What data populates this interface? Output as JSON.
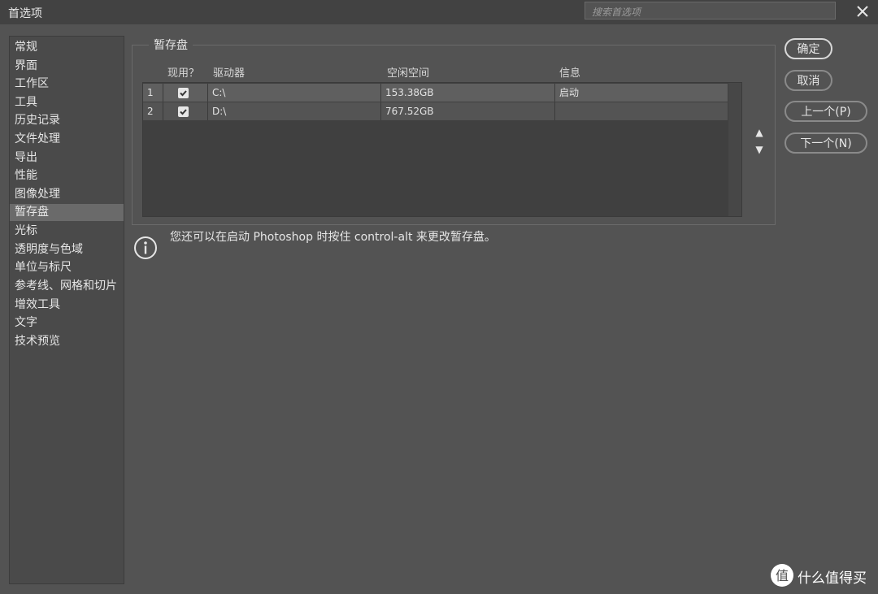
{
  "window": {
    "title": "首选项",
    "search_placeholder": "搜索首选项"
  },
  "sidebar": {
    "items": [
      {
        "label": "常规"
      },
      {
        "label": "界面"
      },
      {
        "label": "工作区"
      },
      {
        "label": "工具"
      },
      {
        "label": "历史记录"
      },
      {
        "label": "文件处理"
      },
      {
        "label": "导出"
      },
      {
        "label": "性能"
      },
      {
        "label": "图像处理"
      },
      {
        "label": "暂存盘",
        "active": true
      },
      {
        "label": "光标"
      },
      {
        "label": "透明度与色域"
      },
      {
        "label": "单位与标尺"
      },
      {
        "label": "参考线、网格和切片"
      },
      {
        "label": "增效工具"
      },
      {
        "label": "文字"
      },
      {
        "label": "技术预览"
      }
    ]
  },
  "scratch": {
    "group_label": "暂存盘",
    "columns": {
      "active": "现用？",
      "drive": "驱动器",
      "free": "空闲空间",
      "info": "信息"
    },
    "rows": [
      {
        "index": "1",
        "active": true,
        "drive": "C:\\",
        "free": "153.38GB",
        "info": "启动"
      },
      {
        "index": "2",
        "active": true,
        "drive": "D:\\",
        "free": "767.52GB",
        "info": ""
      }
    ]
  },
  "buttons": {
    "ok": "确定",
    "cancel": "取消",
    "prev": "上一个(P)",
    "next": "下一个(N)"
  },
  "info_text": "您还可以在启动 Photoshop 时按住 control-alt 来更改暂存盘。",
  "watermark": {
    "text": "什么值得买"
  },
  "colors": {
    "background": "#535353",
    "panel": "#4a4a4a",
    "table_bg": "#404040",
    "selected": "#6a6a6a",
    "text": "#e6e6e6"
  }
}
